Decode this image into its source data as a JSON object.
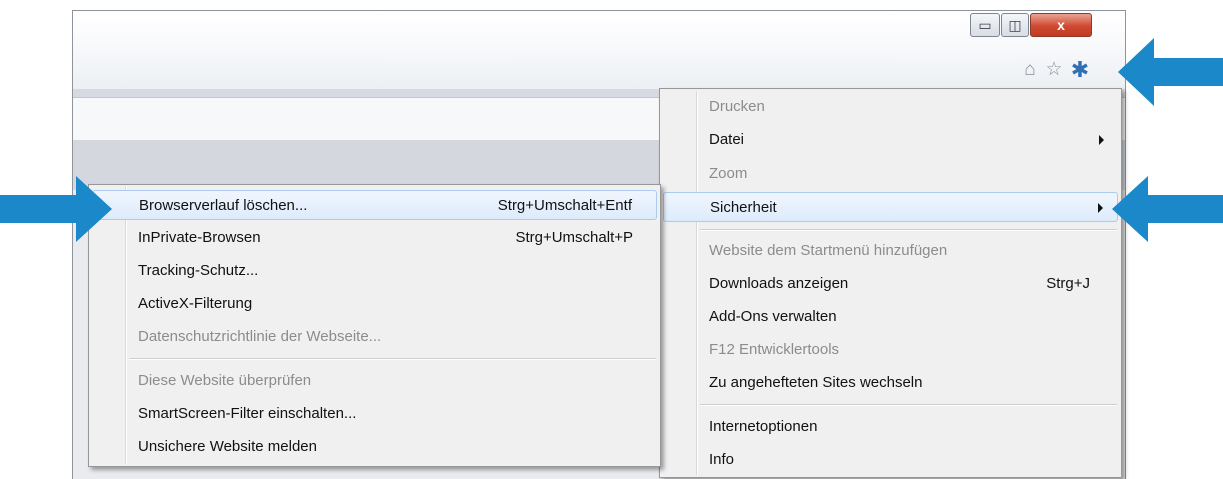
{
  "window": {
    "controls": {
      "minimize": "▭",
      "maximize": "◫",
      "close": "x"
    },
    "toolbar_icons": [
      "home-icon",
      "favorites-star-icon",
      "gear-icon"
    ]
  },
  "colors": {
    "callout_arrow": "#1a88c9",
    "gear_icon": "#2f6fb2",
    "highlight_border": "#a9cbee"
  },
  "tools_menu": {
    "items": [
      {
        "label": "Drucken",
        "disabled": true
      },
      {
        "label": "Datei",
        "submenu": true
      },
      {
        "label": "Zoom",
        "disabled": true
      },
      {
        "label": "Sicherheit",
        "submenu": true,
        "highlighted": true
      },
      {
        "label": "Website dem Startmenü hinzufügen",
        "disabled": true
      },
      {
        "label": "Downloads anzeigen",
        "shortcut": "Strg+J"
      },
      {
        "label": "Add-Ons verwalten"
      },
      {
        "label": "F12 Entwicklertools",
        "disabled": true
      },
      {
        "label": "Zu angehefteten Sites wechseln"
      },
      {
        "label": "Internetoptionen"
      },
      {
        "label": "Info"
      }
    ]
  },
  "security_submenu": {
    "items": [
      {
        "label": "Browserverlauf löschen...",
        "shortcut": "Strg+Umschalt+Entf",
        "highlighted": true
      },
      {
        "label": "InPrivate-Browsen",
        "shortcut": "Strg+Umschalt+P"
      },
      {
        "label": "Tracking-Schutz..."
      },
      {
        "label": "ActiveX-Filterung"
      },
      {
        "label": "Datenschutzrichtlinie der Webseite...",
        "disabled": true
      },
      {
        "label": "Diese Website überprüfen",
        "disabled": true
      },
      {
        "label": "SmartScreen-Filter einschalten..."
      },
      {
        "label": "Unsichere Website melden"
      }
    ]
  }
}
